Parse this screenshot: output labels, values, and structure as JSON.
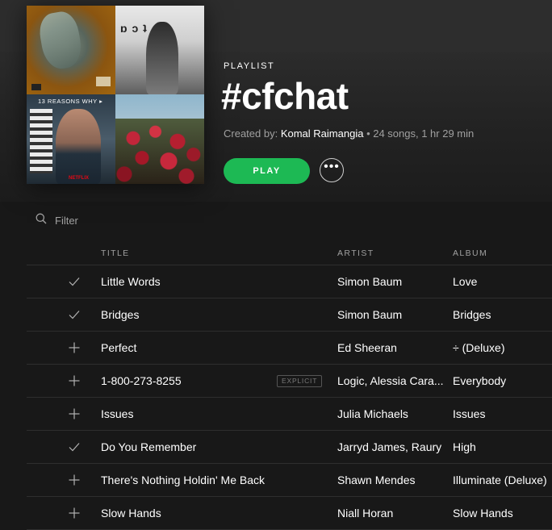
{
  "playlist": {
    "type_label": "PLAYLIST",
    "title": "#cfchat",
    "created_by_label": "Created by:",
    "owner": "Komal Raimangia",
    "stats": "• 24 songs, 1 hr 29 min",
    "play_label": "PLAY",
    "more_label": "•••"
  },
  "mosaic": {
    "tile_tr_text": "ɒ ɔ ʇ",
    "tile_bl_title": "13 REASONS WHY ▸",
    "tile_bl_brand": "NETFLIX"
  },
  "filter": {
    "placeholder": "Filter",
    "value": ""
  },
  "table": {
    "headers": {
      "title": "TITLE",
      "artist": "ARTIST",
      "album": "ALBUM"
    },
    "rows": [
      {
        "status": "saved",
        "title": "Little Words",
        "explicit": "",
        "artist": "Simon Baum",
        "album": "Love"
      },
      {
        "status": "saved",
        "title": "Bridges",
        "explicit": "",
        "artist": "Simon Baum",
        "album": "Bridges"
      },
      {
        "status": "add",
        "title": "Perfect",
        "explicit": "",
        "artist": "Ed Sheeran",
        "album": "÷ (Deluxe)"
      },
      {
        "status": "add",
        "title": "1-800-273-8255",
        "explicit": "EXPLICIT",
        "artist": "Logic, Alessia Cara...",
        "album": "Everybody"
      },
      {
        "status": "add",
        "title": "Issues",
        "explicit": "",
        "artist": "Julia Michaels",
        "album": "Issues"
      },
      {
        "status": "saved",
        "title": "Do You Remember",
        "explicit": "",
        "artist": "Jarryd James, Raury",
        "album": "High"
      },
      {
        "status": "add",
        "title": "There's Nothing Holdin' Me Back",
        "explicit": "",
        "artist": "Shawn Mendes",
        "album": "Illuminate (Deluxe)"
      },
      {
        "status": "add",
        "title": "Slow Hands",
        "explicit": "",
        "artist": "Niall Horan",
        "album": "Slow Hands"
      }
    ]
  },
  "colors": {
    "accent": "#1db954",
    "background": "#181818",
    "text_muted": "#a0a0a0"
  },
  "icons": {
    "saved": "check-icon",
    "add": "plus-icon",
    "filter": "search-icon"
  }
}
